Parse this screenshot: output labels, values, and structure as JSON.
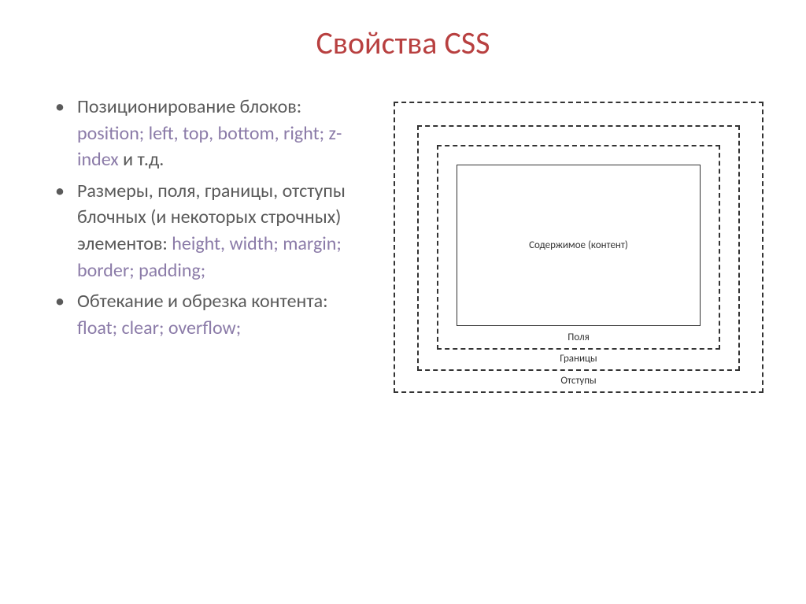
{
  "title": "Свойства CSS",
  "bullets": [
    {
      "text_before": "Позиционирование блоков: ",
      "properties": "position; left, top, bottom, right; z-index",
      "text_after": " и т.д."
    },
    {
      "text_before": "Размеры, поля, границы, отступы блочных  (и некоторых строчных) элементов: ",
      "properties": "height, width; margin; border; padding;",
      "text_after": ""
    },
    {
      "text_before": "Обтекание и обрезка контента: ",
      "properties": "float; clear; overflow;",
      "text_after": ""
    }
  ],
  "box_model": {
    "content": "Содержимое (контент)",
    "padding": "Поля",
    "border": "Границы",
    "margin": "Отступы"
  }
}
